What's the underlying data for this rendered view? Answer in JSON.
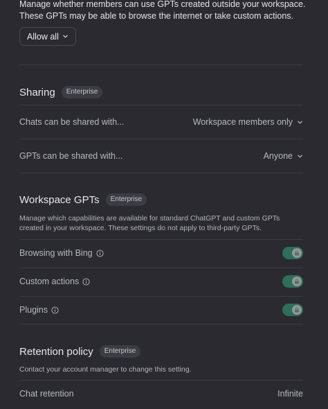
{
  "intro": {
    "text": "Manage whether members can use GPTs created outside your workspace. These GPTs may be able to browse the internet or take custom actions."
  },
  "allow_button": {
    "label": "Allow all",
    "icon": "chevron-down-icon"
  },
  "sharing": {
    "title": "Sharing",
    "badge": "Enterprise",
    "rows": [
      {
        "label": "Chats can be shared with...",
        "value": "Workspace members only"
      },
      {
        "label": "GPTs can be shared with...",
        "value": "Anyone"
      }
    ]
  },
  "workspace_gpts": {
    "title": "Workspace GPTs",
    "badge": "Enterprise",
    "description": "Manage which capabilities are available for standard ChatGPT and custom GPTs created in your workspace. These settings do not apply to third-party GPTs.",
    "toggles": [
      {
        "label": "Browsing with Bing",
        "enabled": true
      },
      {
        "label": "Custom actions",
        "enabled": true
      },
      {
        "label": "Plugins",
        "enabled": true
      }
    ]
  },
  "retention": {
    "title": "Retention policy",
    "badge": "Enterprise",
    "description": "Contact your account manager to change this setting.",
    "row": {
      "label": "Chat retention",
      "value": "Infinite"
    }
  },
  "colors": {
    "background": "#2a2a30",
    "toggle_on": "#2f6e58",
    "divider": "#3b3b42"
  }
}
